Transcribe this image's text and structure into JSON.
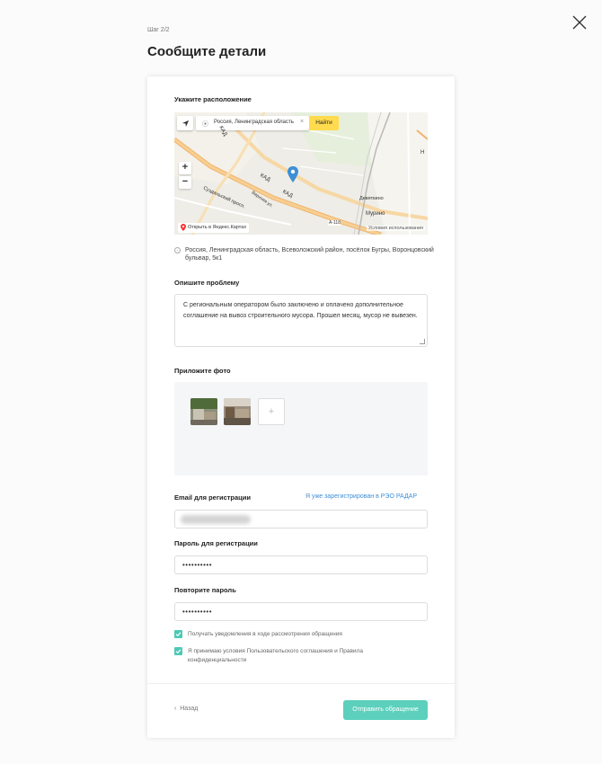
{
  "header": {
    "step": "Шаг 2/2",
    "title": "Сообщите детали"
  },
  "location": {
    "label": "Укажите расположение",
    "search_value": "Россия, Ленинградская область",
    "find_button": "Найти",
    "zoom_in": "+",
    "zoom_out": "−",
    "open_in_maps": "Открыть в Яндекс.Картах",
    "terms": "Условия использования",
    "map_labels": {
      "kad1": "КАД",
      "kad2": "КАД",
      "kad3": "КАД",
      "suzdal": "Суздальский просп.",
      "veren": "Верхняя ул.",
      "devyatkino": "Девяткино",
      "murino": "Мурино",
      "a118": "А-118",
      "n": "Н"
    },
    "address": "Россия, Ленинградская область, Всеволожский район, посёлок Бугры, Воронцовский бульвар, 5к1"
  },
  "problem": {
    "label": "Опишите проблему",
    "text": "С региональным оператором было заключено и оплачено дополнительное соглашение на вывоз строительного мусора. Прошел месяц, мусор не вывезен."
  },
  "photos": {
    "label": "Приложите фото",
    "add": "+"
  },
  "registration": {
    "email_label": "Email для регистрации",
    "already_registered": "Я уже зарегистрирован в РЭО РАДАР",
    "password_label": "Пароль для регистрации",
    "password_value": "••••••••••",
    "repeat_label": "Повторите пароль",
    "repeat_value": "••••••••••"
  },
  "consents": {
    "notifications": "Получать уведомления в ходе рассмотрения обращения",
    "terms": "Я принимаю условия Пользовательского соглашения и Правила конфиденциальности"
  },
  "footer": {
    "back": "Назад",
    "submit": "Отправить обращение"
  },
  "colors": {
    "accent": "#5cd0bc",
    "link": "#3d8fd6",
    "map_find": "#ffdb4d"
  }
}
